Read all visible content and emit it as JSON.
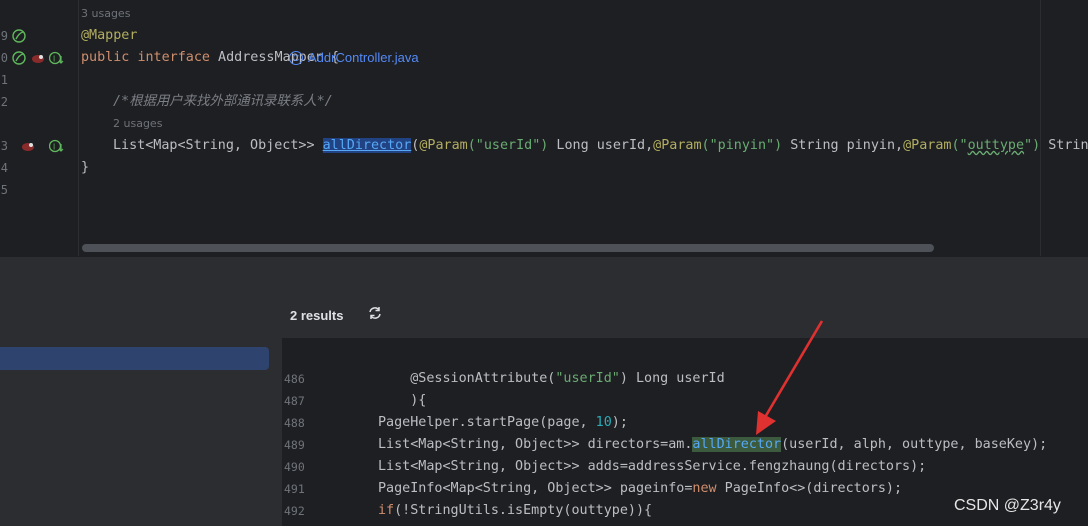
{
  "editor": {
    "gutter_lines": [
      "9",
      "0",
      "1",
      "2",
      "3",
      "4",
      "5"
    ],
    "usages_top": "3 usages",
    "line_annotation": "@Mapper",
    "line_interface": {
      "kw1": "public",
      "kw2": "interface",
      "name": " AddressMapper {"
    },
    "comment": "/*根据用户来找外部通讯录联系人*/",
    "usages_method": "2 usages",
    "method_line": {
      "prefix": "List<Map<String, Object>> ",
      "name": "allDirector",
      "open": "(",
      "ann1": "@Param",
      "str1": "(\"userId\")",
      "p1": " Long userId,",
      "ann2": "@Param",
      "str2": "(\"pinyin\")",
      "p2": " String pinyin,",
      "ann3": "@Param",
      "str3_open": "(\"",
      "str3_word": "outtype",
      "str3_close": "\")",
      "p3": " String"
    },
    "closing_brace": "}"
  },
  "results": {
    "title": "2 results",
    "refresh_icon": "refresh-icon",
    "file_icon_letter": "C",
    "file_name": "AddrController.java",
    "lines": [
      {
        "num": "486",
        "pre": "    @SessionAttribute(",
        "str": "\"userId\"",
        "post": ") Long userId"
      },
      {
        "num": "487",
        "text": "    ){"
      },
      {
        "num": "488",
        "pre": "PageHelper.startPage(page, ",
        "numval": "10",
        "post": ");"
      },
      {
        "num": "489",
        "pre": "List<Map<String, Object>> directors=am.",
        "hl": "allDirector",
        "post": "(userId, alph, outtype, baseKey);"
      },
      {
        "num": "490",
        "text": "List<Map<String, Object>> adds=addressService.fengzhaung(directors);"
      },
      {
        "num": "491",
        "pre": "PageInfo<Map<String, Object>> pageinfo=",
        "kw": "new",
        "post": " PageInfo<>(directors);"
      },
      {
        "num": "492",
        "kw": "if",
        "post": "(!StringUtils.isEmpty(outtype)){"
      }
    ]
  },
  "watermark": "CSDN @Z3r4y",
  "colors": {
    "accent": "#548af7",
    "arrow": "#e03131",
    "selection": "#2e436e"
  }
}
